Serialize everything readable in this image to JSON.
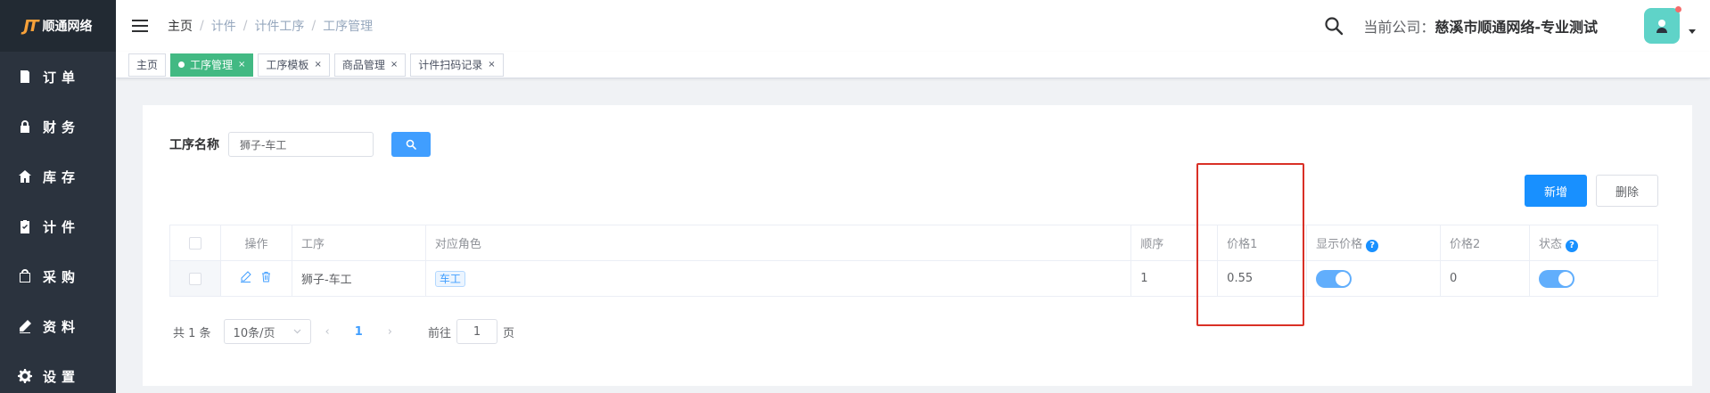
{
  "sidebar": {
    "logo_mark": "JT",
    "logo_text": "顺通网络",
    "items": [
      {
        "label": "订单",
        "icon": "order-icon"
      },
      {
        "label": "财务",
        "icon": "lock-icon"
      },
      {
        "label": "库存",
        "icon": "home-icon"
      },
      {
        "label": "计件",
        "icon": "clipboard-check-icon"
      },
      {
        "label": "采购",
        "icon": "bag-icon"
      },
      {
        "label": "资料",
        "icon": "pen-icon"
      },
      {
        "label": "设置",
        "icon": "gear-icon"
      }
    ]
  },
  "header": {
    "breadcrumb": [
      "主页",
      "计件",
      "计件工序",
      "工序管理"
    ],
    "company_label": "当前公司：",
    "company_name": "慈溪市顺通网络-专业测试"
  },
  "tags": [
    {
      "label": "主页",
      "active": false,
      "closable": false
    },
    {
      "label": "工序管理",
      "active": true,
      "closable": true
    },
    {
      "label": "工序模板",
      "active": false,
      "closable": true
    },
    {
      "label": "商品管理",
      "active": false,
      "closable": true
    },
    {
      "label": "计件扫码记录",
      "active": false,
      "closable": true
    }
  ],
  "filter": {
    "label": "工序名称",
    "value": "狮子-车工"
  },
  "buttons": {
    "add": "新增",
    "delete": "删除"
  },
  "table": {
    "headers": [
      "操作",
      "工序",
      "对应角色",
      "顺序",
      "价格1",
      "显示价格",
      "价格2",
      "状态"
    ],
    "rows": [
      {
        "process": "狮子-车工",
        "role": "车工",
        "order": "1",
        "price1": "0.55",
        "show_price": true,
        "price2": "0",
        "status": true
      }
    ]
  },
  "pager": {
    "total": "共 1 条",
    "page_size": "10条/页",
    "current": "1",
    "goto_label": "前往",
    "goto_value": "1",
    "page_suffix": "页"
  },
  "colors": {
    "sidebar_bg": "#2b333e",
    "active_tag": "#42b983",
    "primary": "#1890ff",
    "highlight": "#d93026"
  }
}
